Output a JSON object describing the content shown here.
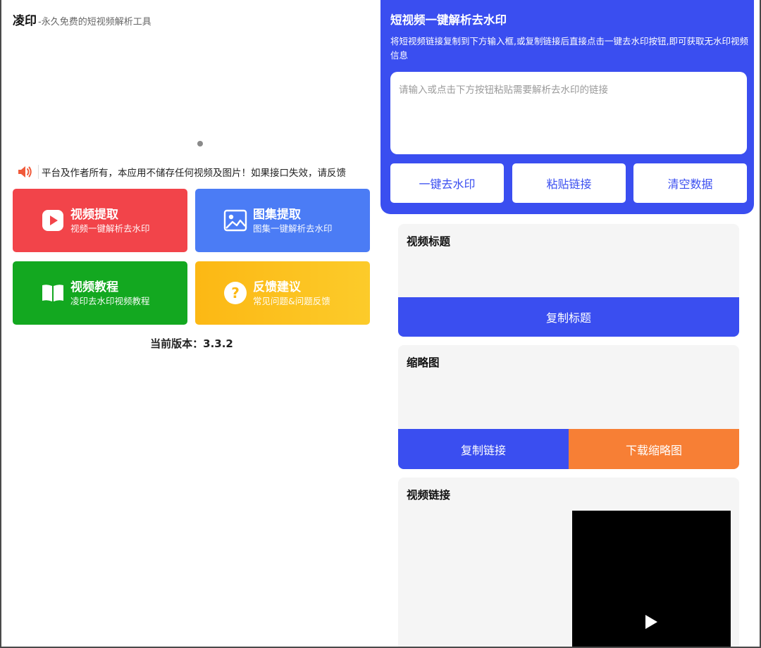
{
  "app": {
    "name": "凌印",
    "slogan": "-永久免费的短视频解析工具"
  },
  "notice": {
    "text": "平台及作者所有，本应用不储存任何视频及图片！如果接口失效，请反馈"
  },
  "cards": [
    {
      "title": "视频提取",
      "subtitle": "视频一键解析去水印",
      "icon": "play-icon",
      "color": "#f2444a"
    },
    {
      "title": "图集提取",
      "subtitle": "图集一键解析去水印",
      "icon": "image-icon",
      "color": "#4b7cf5"
    },
    {
      "title": "视频教程",
      "subtitle": "凌印去水印视频教程",
      "icon": "book-icon",
      "color": "#13a820"
    },
    {
      "title": "反馈建议",
      "subtitle": "常见问题&问题反馈",
      "icon": "question-icon",
      "color": "#fcb814"
    }
  ],
  "version_text": "当前版本：3.3.2",
  "parser": {
    "title": "短视频一键解析去水印",
    "description": "将短视频链接复制到下方输入框,或复制链接后直接点击一键去水印按钮,即可获取无水印视频信息",
    "input_placeholder": "请输入或点击下方按钮粘贴需要解析去水印的链接",
    "input_value": "",
    "buttons": {
      "remove_watermark": "一键去水印",
      "paste_link": "粘贴链接",
      "clear_data": "清空数据"
    }
  },
  "result": {
    "video_title_label": "视频标题",
    "copy_title": "复制标题",
    "thumbnail_label": "缩略图",
    "copy_link": "复制链接",
    "download_thumbnail": "下载缩略图",
    "video_link_label": "视频链接"
  },
  "colors": {
    "primary": "#3a4ef0",
    "orange": "#f77f35",
    "red": "#f2444a",
    "green": "#13a820",
    "yellow": "#fcb814"
  }
}
